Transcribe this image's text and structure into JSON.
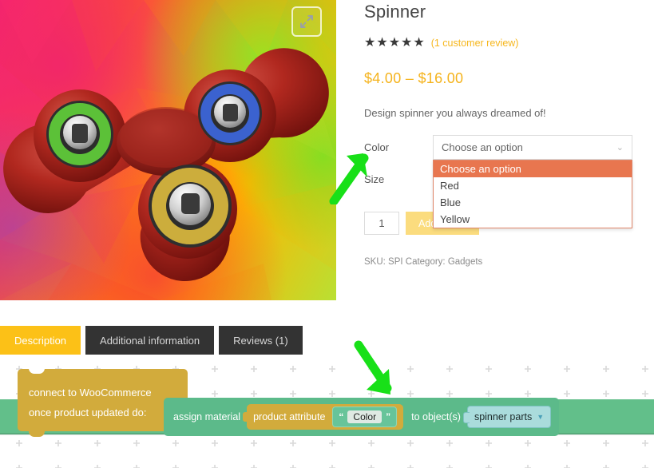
{
  "product": {
    "title": "Spinner",
    "stars": "★★★★★",
    "review_link": "(1 customer review)",
    "price_min": "$4.00",
    "price_sep": "–",
    "price_max": "$16.00",
    "short_description": "Design spinner you always dreamed of!",
    "meta": "SKU: SPI Category: Gadgets",
    "fullscreen_icon": "expand-icon"
  },
  "variations": {
    "color": {
      "label": "Color",
      "selected": "Choose an option",
      "chevron": "⌄",
      "options": [
        {
          "label": "Choose an option",
          "selected": true
        },
        {
          "label": "Red",
          "selected": false
        },
        {
          "label": "Blue",
          "selected": false
        },
        {
          "label": "Yellow",
          "selected": false
        }
      ]
    },
    "size": {
      "label": "Size"
    }
  },
  "cart": {
    "quantity": "1",
    "add_to_cart_label": "Add to cart"
  },
  "tabs": [
    {
      "label": "Description",
      "active": true
    },
    {
      "label": "Additional information",
      "active": false
    },
    {
      "label": "Reviews (1)",
      "active": false
    }
  ],
  "blocks": {
    "hat_line1": "connect to WooCommerce",
    "hat_line2": "once product updated do:",
    "assign_label": "assign material",
    "attribute_label": "product attribute",
    "quote_open": "“",
    "quote_close": "”",
    "attribute_value": "Color",
    "to_objects_label": "to object(s)",
    "object_value": "spinner parts",
    "object_arrow": "▼"
  },
  "colors": {
    "accent_yellow": "#fcc117",
    "price_gold": "#f5b31c",
    "dropdown_highlight": "#e8764f",
    "block_yellow": "#d2ab3c",
    "block_green": "#5cba8a",
    "block_teal": "#aadcdc",
    "tab_dark": "#333333",
    "annotation_green": "#18e018"
  }
}
